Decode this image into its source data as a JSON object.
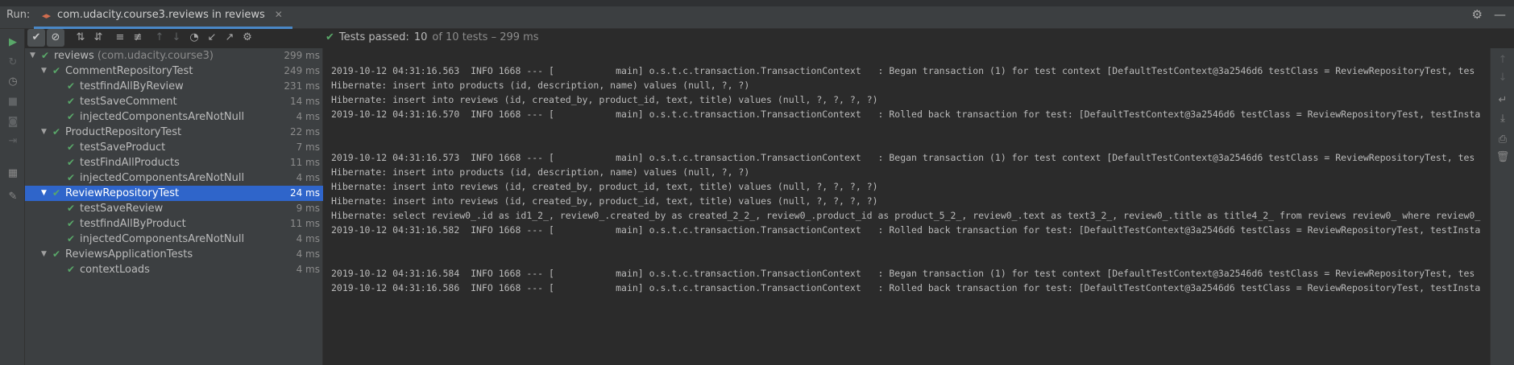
{
  "header": {
    "run_label": "Run:",
    "tab_title": "com.udacity.course3.reviews in reviews"
  },
  "status": {
    "prefix": "Tests passed:",
    "passed": "10",
    "total_text": "of 10 tests – 299 ms"
  },
  "tree": [
    {
      "name": "reviews",
      "pkg": "(com.udacity.course3)",
      "time": "299 ms",
      "level": 0,
      "expandable": true
    },
    {
      "name": "CommentRepositoryTest",
      "time": "249 ms",
      "level": 1,
      "expandable": true
    },
    {
      "name": "testfindAllByReview",
      "time": "231 ms",
      "level": 2
    },
    {
      "name": "testSaveComment",
      "time": "14 ms",
      "level": 2
    },
    {
      "name": "injectedComponentsAreNotNull",
      "time": "4 ms",
      "level": 2
    },
    {
      "name": "ProductRepositoryTest",
      "time": "22 ms",
      "level": 1,
      "expandable": true
    },
    {
      "name": "testSaveProduct",
      "time": "7 ms",
      "level": 2
    },
    {
      "name": "testFindAllProducts",
      "time": "11 ms",
      "level": 2
    },
    {
      "name": "injectedComponentsAreNotNull",
      "time": "4 ms",
      "level": 2
    },
    {
      "name": "ReviewRepositoryTest",
      "time": "24 ms",
      "level": 1,
      "expandable": true,
      "selected": true
    },
    {
      "name": "testSaveReview",
      "time": "9 ms",
      "level": 2
    },
    {
      "name": "testfindAllByProduct",
      "time": "11 ms",
      "level": 2
    },
    {
      "name": "injectedComponentsAreNotNull",
      "time": "4 ms",
      "level": 2
    },
    {
      "name": "ReviewsApplicationTests",
      "time": "4 ms",
      "level": 1,
      "expandable": true
    },
    {
      "name": "contextLoads",
      "time": "4 ms",
      "level": 2
    }
  ],
  "console": [
    "2019-10-12 04:31:16.563  INFO 1668 --- [           main] o.s.t.c.transaction.TransactionContext   : Began transaction (1) for test context [DefaultTestContext@3a2546d6 testClass = ReviewRepositoryTest, tes",
    "Hibernate: insert into products (id, description, name) values (null, ?, ?)",
    "Hibernate: insert into reviews (id, created_by, product_id, text, title) values (null, ?, ?, ?, ?)",
    "2019-10-12 04:31:16.570  INFO 1668 --- [           main] o.s.t.c.transaction.TransactionContext   : Rolled back transaction for test: [DefaultTestContext@3a2546d6 testClass = ReviewRepositoryTest, testInsta",
    "",
    "",
    "2019-10-12 04:31:16.573  INFO 1668 --- [           main] o.s.t.c.transaction.TransactionContext   : Began transaction (1) for test context [DefaultTestContext@3a2546d6 testClass = ReviewRepositoryTest, tes",
    "Hibernate: insert into products (id, description, name) values (null, ?, ?)",
    "Hibernate: insert into reviews (id, created_by, product_id, text, title) values (null, ?, ?, ?, ?)",
    "Hibernate: insert into reviews (id, created_by, product_id, text, title) values (null, ?, ?, ?, ?)",
    "Hibernate: select review0_.id as id1_2_, review0_.created_by as created_2_2_, review0_.product_id as product_5_2_, review0_.text as text3_2_, review0_.title as title4_2_ from reviews review0_ where review0_",
    "2019-10-12 04:31:16.582  INFO 1668 --- [           main] o.s.t.c.transaction.TransactionContext   : Rolled back transaction for test: [DefaultTestContext@3a2546d6 testClass = ReviewRepositoryTest, testInsta",
    "",
    "",
    "2019-10-12 04:31:16.584  INFO 1668 --- [           main] o.s.t.c.transaction.TransactionContext   : Began transaction (1) for test context [DefaultTestContext@3a2546d6 testClass = ReviewRepositoryTest, tes",
    "2019-10-12 04:31:16.586  INFO 1668 --- [           main] o.s.t.c.transaction.TransactionContext   : Rolled back transaction for test: [DefaultTestContext@3a2546d6 testClass = ReviewRepositoryTest, testInsta"
  ],
  "colors": {
    "pass": "#59a869",
    "selection": "#2f65ca",
    "tab_underline": "#4a88c7"
  },
  "icons": {
    "left_toolbar": [
      "rerun-icon",
      "rerun-failed-icon",
      "toggle-auto-test-icon",
      "stop-icon",
      "screenshot-icon",
      "export-icon",
      "layout-icon",
      "pin-icon"
    ],
    "tree_toolbar": [
      "show-passed-icon",
      "show-ignored-icon",
      "sort-alpha-icon",
      "sort-duration-icon",
      "expand-all-icon",
      "collapse-all-icon",
      "previous-failed-icon",
      "next-failed-icon",
      "history-icon",
      "import-icon",
      "export-results-icon",
      "settings-icon"
    ],
    "right_toolbar": [
      "scroll-up-icon",
      "scroll-down-icon",
      "soft-wrap-icon",
      "scroll-to-end-icon",
      "print-icon",
      "clear-icon"
    ]
  }
}
